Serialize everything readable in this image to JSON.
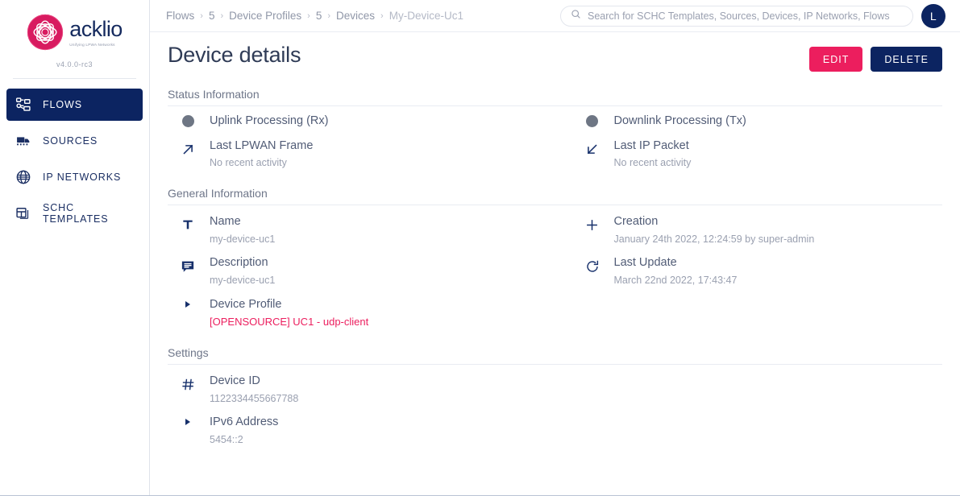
{
  "brand": {
    "name": "acklio",
    "tagline": "Unifying LPWA Networks",
    "version": "v4.0.0-rc3"
  },
  "sidebar": {
    "items": [
      {
        "label": "FLOWS",
        "icon": "flows-icon",
        "active": true
      },
      {
        "label": "SOURCES",
        "icon": "sources-icon",
        "active": false
      },
      {
        "label": "IP NETWORKS",
        "icon": "globe-icon",
        "active": false
      },
      {
        "label": "SCHC TEMPLATES",
        "icon": "templates-icon",
        "active": false
      }
    ]
  },
  "topbar": {
    "breadcrumb": [
      "Flows",
      "5",
      "Device Profiles",
      "5",
      "Devices",
      "My-Device-Uc1"
    ],
    "breadcrumb_separator": "›",
    "search": {
      "placeholder": "Search for SCHC Templates, Sources, Devices, IP Networks, Flows",
      "value": "",
      "icon": "search-icon"
    },
    "avatar_initial": "L"
  },
  "page": {
    "title": "Device details",
    "edit_label": "EDIT",
    "delete_label": "DELETE"
  },
  "status_section": {
    "title": "Status Information",
    "left": [
      {
        "label": "Uplink Processing (Rx)",
        "value": "",
        "icon": "status-dot-icon",
        "kind": "dot"
      },
      {
        "label": "Last LPWAN Frame",
        "value": "No recent activity",
        "icon": "arrow-up-right-icon",
        "kind": "icon"
      }
    ],
    "right": [
      {
        "label": "Downlink Processing (Tx)",
        "value": "",
        "icon": "status-dot-icon",
        "kind": "dot"
      },
      {
        "label": "Last IP Packet",
        "value": "No recent activity",
        "icon": "arrow-down-left-icon",
        "kind": "icon"
      }
    ]
  },
  "general_section": {
    "title": "General Information",
    "left": [
      {
        "label": "Name",
        "value": "my-device-uc1",
        "icon": "text-icon"
      },
      {
        "label": "Description",
        "value": "my-device-uc1",
        "icon": "comment-icon"
      },
      {
        "label": "Device Profile",
        "value": "[OPENSOURCE] UC1 - udp-client",
        "icon": "caret-right-icon",
        "link": true
      }
    ],
    "right": [
      {
        "label": "Creation",
        "value": "January 24th 2022, 12:24:59 by super-admin",
        "icon": "plus-icon"
      },
      {
        "label": "Last Update",
        "value": "March 22nd 2022, 17:43:47",
        "icon": "refresh-icon"
      }
    ]
  },
  "settings_section": {
    "title": "Settings",
    "left": [
      {
        "label": "Device ID",
        "value": "1122334455667788",
        "icon": "hash-icon"
      },
      {
        "label": "IPv6 Address",
        "value": "5454::2",
        "icon": "caret-right-icon"
      }
    ],
    "right": []
  },
  "colors": {
    "navy": "#0c2461",
    "pink": "#ec1e5e",
    "status_grey": "#6e7684",
    "muted_text": "#9aa0b0"
  }
}
